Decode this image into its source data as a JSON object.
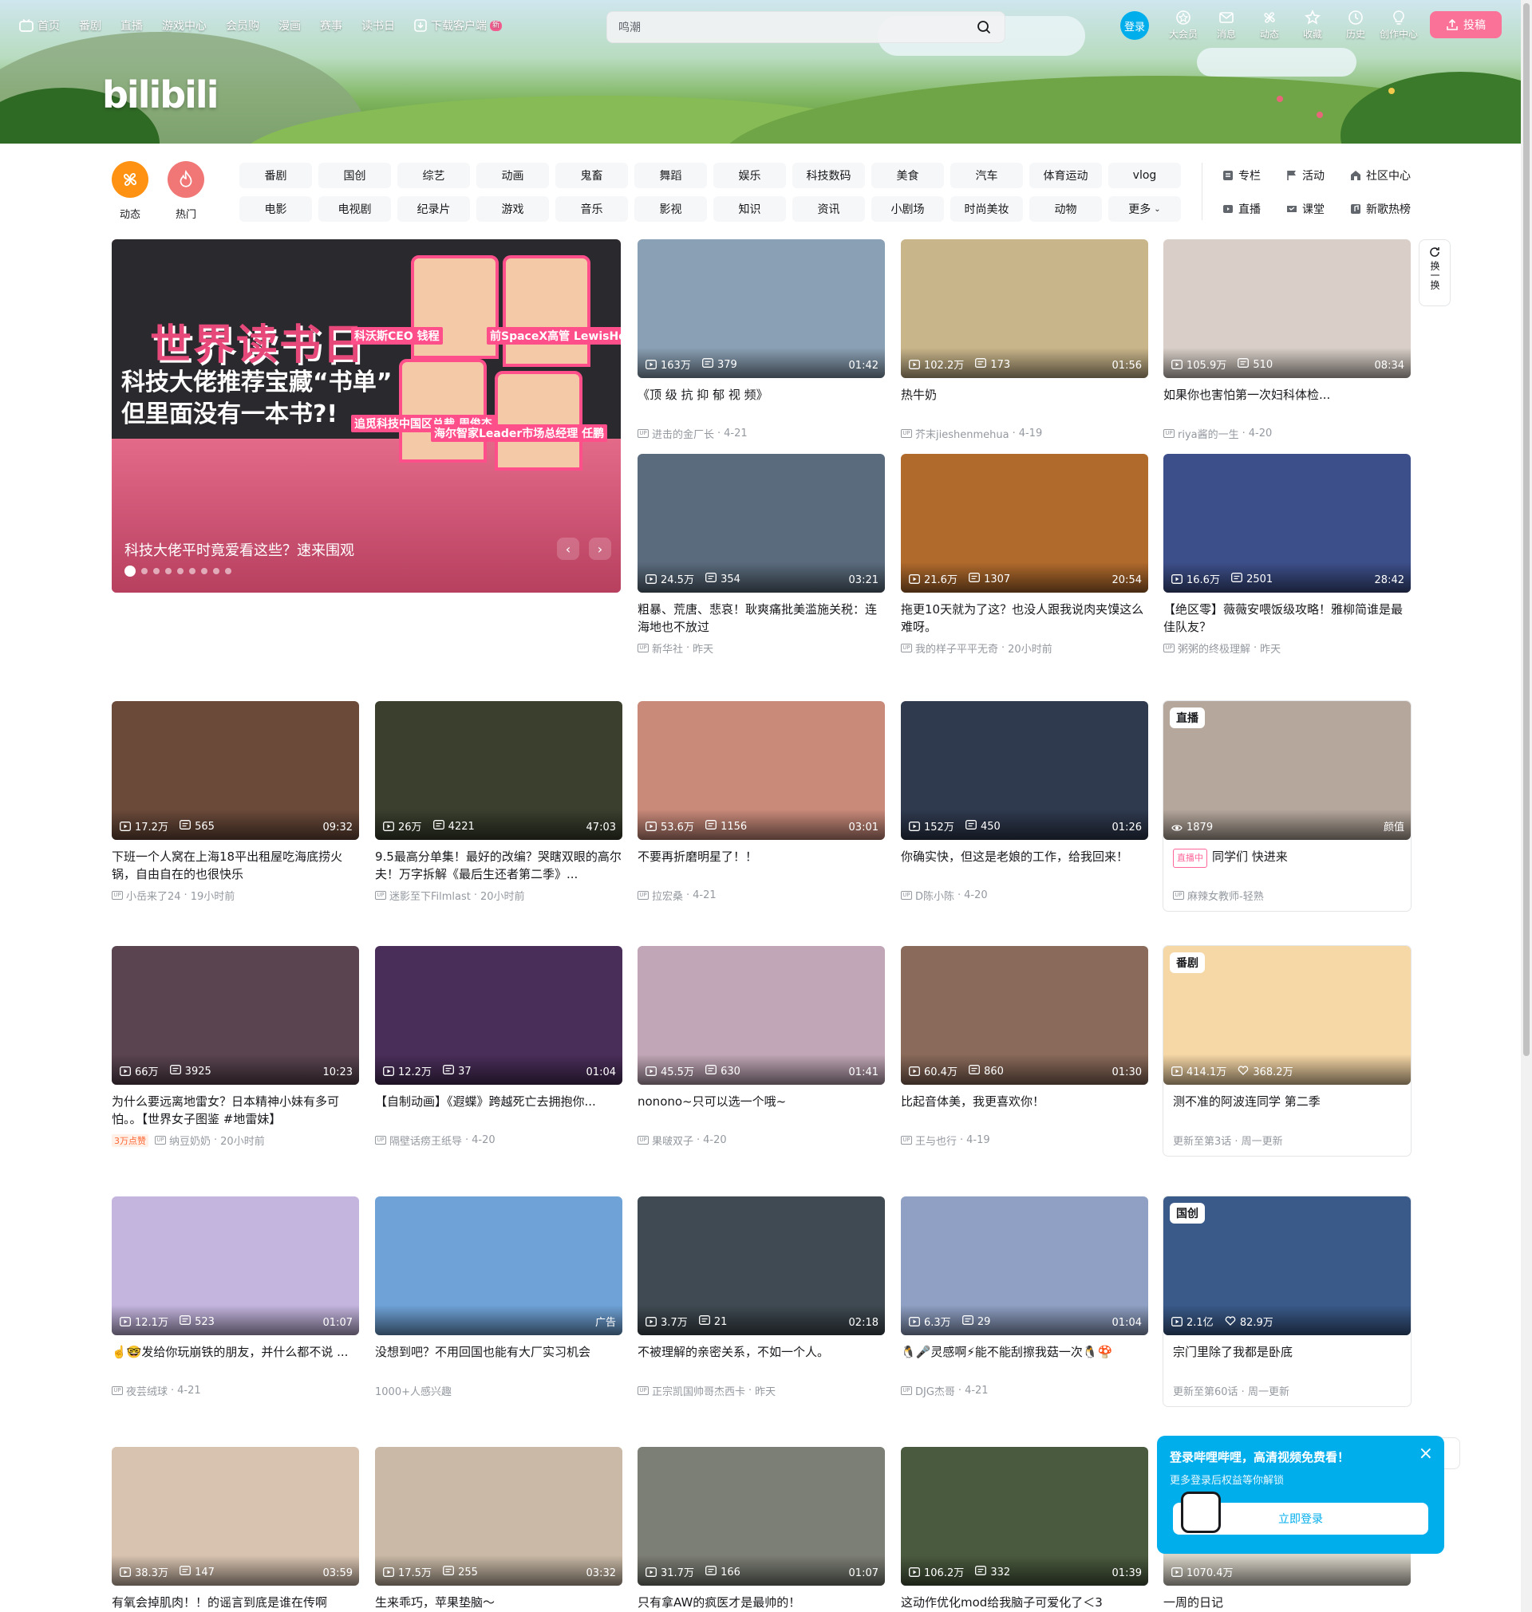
{
  "header": {
    "nav": [
      {
        "label": "首页",
        "icon": "tv-icon"
      },
      {
        "label": "番剧"
      },
      {
        "label": "直播"
      },
      {
        "label": "游戏中心"
      },
      {
        "label": "会员购"
      },
      {
        "label": "漫画"
      },
      {
        "label": "赛事"
      },
      {
        "label": "读书日"
      },
      {
        "label": "下载客户端",
        "icon": "download-icon",
        "badge": "新"
      }
    ],
    "logo": "bilibili",
    "search_placeholder": "鸣潮",
    "login": "登录",
    "right_nav": [
      "大会员",
      "消息",
      "动态",
      "收藏",
      "历史",
      "创作中心"
    ],
    "upload": "投稿"
  },
  "channels": {
    "circles": [
      {
        "label": "动态",
        "color": "#ff9212",
        "icon": "pinwheel-icon"
      },
      {
        "label": "热门",
        "color": "#f07775",
        "icon": "flame-icon"
      }
    ],
    "tags": [
      "番剧",
      "国创",
      "综艺",
      "动画",
      "鬼畜",
      "舞蹈",
      "娱乐",
      "科技数码",
      "美食",
      "汽车",
      "体育运动",
      "vlog",
      "电影",
      "电视剧",
      "纪录片",
      "游戏",
      "音乐",
      "影视",
      "知识",
      "资讯",
      "小剧场",
      "时尚美妆",
      "动物",
      "更多"
    ],
    "links": [
      {
        "label": "专栏",
        "icon": "column-icon"
      },
      {
        "label": "活动",
        "icon": "flag-icon"
      },
      {
        "label": "社区中心",
        "icon": "community-icon"
      },
      {
        "label": "直播",
        "icon": "live-icon"
      },
      {
        "label": "课堂",
        "icon": "classroom-icon"
      },
      {
        "label": "新歌热榜",
        "icon": "music-icon"
      }
    ]
  },
  "carousel": {
    "headline": "世界读书日",
    "subhead": "科技大佬推荐宝藏“书单”\n但里面没有一本书?!",
    "people": [
      {
        "label": "科沃斯CEO 钱程"
      },
      {
        "label": "前SpaceX高管 LewisHong"
      },
      {
        "label": "追觅科技中国区总裁 周俊杰"
      },
      {
        "label": "海尔智家Leader市场总经理 任鹏"
      }
    ],
    "caption": "科技大佬平时竟爱看这些？速来围观",
    "dots": 9,
    "active_dot": 0
  },
  "refresh": "换一换",
  "cards": [
    {
      "title": "《顶 级 抗 抑 郁 视 频》",
      "views": "163万",
      "danmaku": "379",
      "duration": "01:42",
      "author": "进击的金厂长",
      "date": "4-21",
      "bg": "#8aa0b4"
    },
    {
      "title": "热牛奶",
      "views": "102.2万",
      "danmaku": "173",
      "duration": "01:56",
      "author": "芥末jieshenmehua",
      "date": "4-19",
      "bg": "#c9b58a"
    },
    {
      "title": "如果你也害怕第一次妇科体检...",
      "views": "105.9万",
      "danmaku": "510",
      "duration": "08:34",
      "author": "riya酱的一生",
      "date": "4-20",
      "bg": "#d9cfc8"
    },
    {
      "title": "粗暴、荒唐、悲哀！耿爽痛批美滥施关税：连海地也不放过",
      "views": "24.5万",
      "danmaku": "354",
      "duration": "03:21",
      "author": "新华社",
      "date": "昨天",
      "bg": "#5a6b7d"
    },
    {
      "title": "拖更10天就为了这？也没人跟我说肉夹馍这么难呀。",
      "views": "21.6万",
      "danmaku": "1307",
      "duration": "20:54",
      "author": "我的样子平平无奇",
      "date": "20小时前",
      "bg": "#b06a2c"
    },
    {
      "title": "【绝区零】薇薇安喂饭级攻略！雅柳简谁是最佳队友？",
      "views": "16.6万",
      "danmaku": "2501",
      "duration": "28:42",
      "author": "粥粥的终极理解",
      "date": "昨天",
      "bg": "#3d4f8a"
    },
    {
      "title": "下班一个人窝在上海18平出租屋吃海底捞火锅，自由自在的也很快乐",
      "views": "17.2万",
      "danmaku": "565",
      "duration": "09:32",
      "author": "小岳来了24",
      "date": "19小时前",
      "bg": "#6b4a3a"
    },
    {
      "title": "9.5最高分单集！最好的改编？哭瞎双眼的高尔夫！万字拆解《最后生还者第二季》...",
      "views": "26万",
      "danmaku": "4221",
      "duration": "47:03",
      "author": "迷影至下Filmlast",
      "date": "20小时前",
      "bg": "#3a3f2e"
    },
    {
      "title": "不要再折磨明星了！！",
      "views": "53.6万",
      "danmaku": "1156",
      "duration": "03:01",
      "author": "拉宏桑",
      "date": "4-21",
      "bg": "#c98a7a"
    },
    {
      "title": "你确实快，但这是老娘的工作，给我回来！",
      "views": "152万",
      "danmaku": "450",
      "duration": "01:26",
      "author": "D陈小陈",
      "date": "4-20",
      "bg": "#2f3a4f"
    },
    {
      "title": "为什么要远离地雷女？日本精神小妹有多可怕。。【世界女子图鉴 #地雷妹】",
      "views": "66万",
      "danmaku": "3925",
      "duration": "10:23",
      "author": "纳豆奶奶",
      "date": "20小时前",
      "tag": "3万点赞",
      "bg": "#5a4450"
    },
    {
      "title": "【自制动画】《遐蝶》跨越死亡去拥抱你...",
      "views": "12.2万",
      "danmaku": "37",
      "duration": "01:04",
      "author": "隔壁话痨王纸导",
      "date": "4-20",
      "bg": "#4a2e5a"
    },
    {
      "title": "nonono~只可以选一个哦~",
      "views": "45.5万",
      "danmaku": "630",
      "duration": "01:41",
      "author": "果啵双子",
      "date": "4-20",
      "bg": "#c0a6b6"
    },
    {
      "title": "比起音体美，我更喜欢你！",
      "views": "60.4万",
      "danmaku": "860",
      "duration": "01:30",
      "author": "王与也行",
      "date": "4-19",
      "bg": "#8a6a5a"
    },
    {
      "title": "☝️🤓发给你玩崩铁的朋友，并什么都不说 ...",
      "views": "12.1万",
      "danmaku": "523",
      "duration": "01:07",
      "author": "夜芸绒球",
      "date": "4-21",
      "bg": "#c4b5df"
    },
    {
      "title": "没想到吧？不用回国也能有大厂实习机会",
      "duration": "广告",
      "meta": "1000+人感兴趣",
      "ad": true,
      "bg": "#6fa3d8"
    },
    {
      "title": "不被理解的亲密关系，不如一个人。",
      "views": "3.7万",
      "danmaku": "21",
      "duration": "02:18",
      "author": "正宗凯国帅哥杰西卡",
      "date": "昨天",
      "bg": "#3f4a52"
    },
    {
      "title": "🐧🎤灵感啊⚡能不能刮擦我菇一次🐧🍄",
      "views": "6.3万",
      "danmaku": "29",
      "duration": "01:04",
      "author": "DJG杰哥",
      "date": "4-21",
      "bg": "#8fa0c4"
    },
    {
      "title": "有氧会掉肌肉！！的谣言到底是谁在传啊",
      "views": "38.3万",
      "danmaku": "147",
      "duration": "03:59",
      "bg": "#d8c3b0"
    },
    {
      "title": "生来乖巧，苹果垫脑～",
      "views": "17.5万",
      "danmaku": "255",
      "duration": "03:32",
      "bg": "#c9b9a6"
    },
    {
      "title": "只有拿AW的疯医才是最帅的！",
      "views": "31.7万",
      "danmaku": "166",
      "duration": "01:07",
      "bg": "#7c7f76"
    },
    {
      "title": "这动作优化mod给我脑子可爱化了＜3",
      "views": "106.2万",
      "danmaku": "332",
      "duration": "01:39",
      "bg": "#4a5a3e"
    },
    {
      "title": "一周的日记",
      "views": "1070.4万",
      "bg": "#d9d4c8"
    }
  ],
  "specials": [
    {
      "badge": "直播",
      "title": "同学们 快进来",
      "livepill": "直播中",
      "views": "1879",
      "right": "颜值",
      "author": "麻辣女教师-轻熟",
      "bg": "#b5a79c"
    },
    {
      "badge": "番剧",
      "title": "测不准的阿波连同学 第二季",
      "views": "414.1万",
      "likes": "368.2万",
      "meta": "更新至第3话 · 周一更新",
      "bg": "#f6d7a6"
    },
    {
      "badge": "国创",
      "title": "宗门里除了我都是卧底",
      "views": "2.1亿",
      "likes": "82.9万",
      "meta": "更新至第60话 · 周一更新",
      "bg": "#3a5a8a"
    }
  ],
  "popup": {
    "title": "登录哔哩哔哩，高清视频免费看！",
    "subtitle": "更多登录后权益等你解锁",
    "button": "立即登录"
  }
}
